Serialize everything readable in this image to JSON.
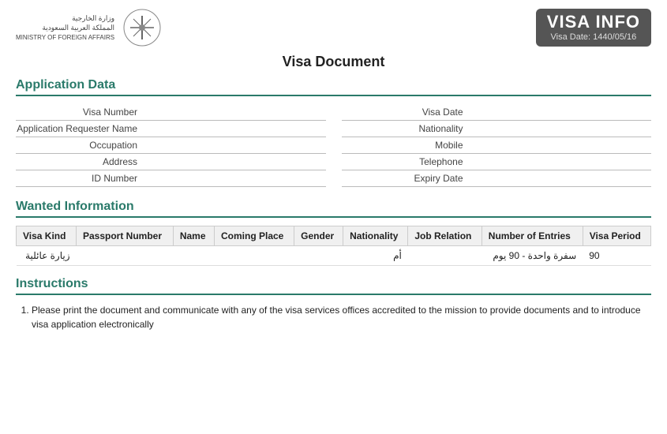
{
  "header": {
    "logo_line1": "وزارة الخارجية",
    "logo_line2": "المملكة العربية السعودية",
    "logo_line3": "MINISTRY OF FOREIGN AFFAIRS",
    "visa_info_title": "VISA INFO",
    "visa_date_label": "Visa Date:",
    "visa_date_value": "1440/05/16"
  },
  "page_title": "Visa Document",
  "application_data": {
    "heading": "Application Data",
    "left_fields": [
      {
        "label": "Visa Number",
        "value": ""
      },
      {
        "label": "Application Requester Name",
        "value": ""
      },
      {
        "label": "Occupation",
        "value": ""
      },
      {
        "label": "Address",
        "value": ""
      },
      {
        "label": "ID Number",
        "value": ""
      }
    ],
    "right_fields": [
      {
        "label": "Visa Date",
        "value": ""
      },
      {
        "label": "Nationality",
        "value": ""
      },
      {
        "label": "Mobile",
        "value": ""
      },
      {
        "label": "Telephone",
        "value": ""
      },
      {
        "label": "Expiry Date",
        "value": ""
      }
    ]
  },
  "wanted_information": {
    "heading": "Wanted Information",
    "columns": [
      "Visa Kind",
      "Passport Number",
      "Name",
      "Coming Place",
      "Gender",
      "Nationality",
      "Job Relation",
      "Number of Entries",
      "Visa Period"
    ],
    "rows": [
      {
        "visa_kind": "زيارة عائلية",
        "passport_number": "",
        "name": "",
        "coming_place": "",
        "gender": "",
        "nationality": "أم",
        "job_relation": "",
        "number_of_entries": "سفرة واحدة - 90 يوم",
        "visa_period": "90"
      }
    ]
  },
  "instructions": {
    "heading": "Instructions",
    "items": [
      "Please print the document and communicate with any of the visa services offices accredited to the mission to provide documents and to introduce visa application electronically"
    ]
  }
}
